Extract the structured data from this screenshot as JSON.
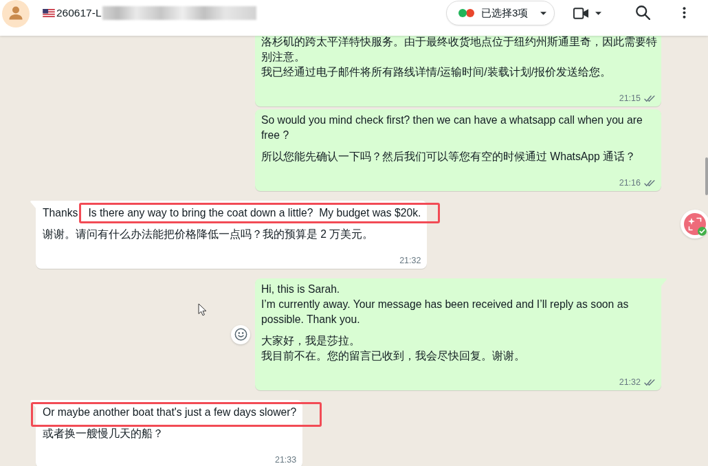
{
  "header": {
    "contact": {
      "name": "260617-L",
      "redacted": true
    },
    "label_filter": {
      "text": "已选择3项"
    }
  },
  "messages": [
    {
      "kind": "outgoing",
      "tail": false,
      "hovered": false,
      "paragraphs": [
        {
          "lines": [
            {
              "segments": [
                {
                  "text": "洛杉矶的跨太平洋特快服务。由于最终收货地点位于纽约州斯通里奇，因此需要特别注意。",
                  "highlighted": false
                }
              ]
            },
            {
              "segments": [
                {
                  "text": "我已经通过电子邮件将所有路线详情/运输时间/装载计划/报价发送给您。",
                  "highlighted": false
                }
              ]
            }
          ]
        }
      ],
      "time": "21:15",
      "read": false
    },
    {
      "kind": "outgoing",
      "tail": false,
      "hovered": false,
      "paragraphs": [
        {
          "lines": [
            {
              "segments": [
                {
                  "text": "So would you mind check first? then we can have a whatsapp call when you are free ?",
                  "highlighted": false
                }
              ]
            }
          ]
        },
        {
          "lines": [
            {
              "segments": [
                {
                  "text": "所以您能先确认一下吗？然后我们可以等您有空的时候通过 WhatsApp 通话？",
                  "highlighted": false
                }
              ]
            }
          ]
        }
      ],
      "time": "21:16",
      "read": false
    },
    {
      "kind": "incoming",
      "tail": true,
      "hovered": false,
      "paragraphs": [
        {
          "lines": [
            {
              "segments": [
                {
                  "text": "Thanks",
                  "highlighted": false
                },
                {
                  "text": "Is there any way to bring the coat down a little?  My budget was $20k.",
                  "highlighted": true
                }
              ]
            }
          ]
        },
        {
          "lines": [
            {
              "segments": [
                {
                  "text": "谢谢。请问有什么办法能把价格降低一点吗？我的预算是 2 万美元。",
                  "highlighted": false
                }
              ]
            }
          ]
        }
      ],
      "time": "21:32"
    },
    {
      "kind": "outgoing",
      "tail": true,
      "hovered": true,
      "paragraphs": [
        {
          "lines": [
            {
              "segments": [
                {
                  "text": "Hi, this is Sarah.",
                  "highlighted": false
                }
              ]
            },
            {
              "segments": [
                {
                  "text": "I’m currently away. Your message has been received and I’ll reply as soon as possible. Thank you.",
                  "highlighted": false
                }
              ]
            }
          ]
        },
        {
          "lines": [
            {
              "segments": [
                {
                  "text": "大家好，我是莎拉。",
                  "highlighted": false
                }
              ]
            },
            {
              "segments": [
                {
                  "text": "我目前不在。您的留言已收到，我会尽快回复。谢谢。",
                  "highlighted": false
                }
              ]
            }
          ]
        }
      ],
      "time": "21:32",
      "read": false
    },
    {
      "kind": "incoming",
      "tail": true,
      "hovered": false,
      "paragraphs": [
        {
          "lines": [
            {
              "segments": [
                {
                  "text": "Or maybe another boat that's just a few days slower?",
                  "highlighted": true
                }
              ]
            }
          ]
        },
        {
          "lines": [
            {
              "segments": [
                {
                  "text": "或者换一艘慢几天的船？",
                  "highlighted": false
                }
              ]
            }
          ]
        }
      ],
      "time": "21:33"
    }
  ]
}
